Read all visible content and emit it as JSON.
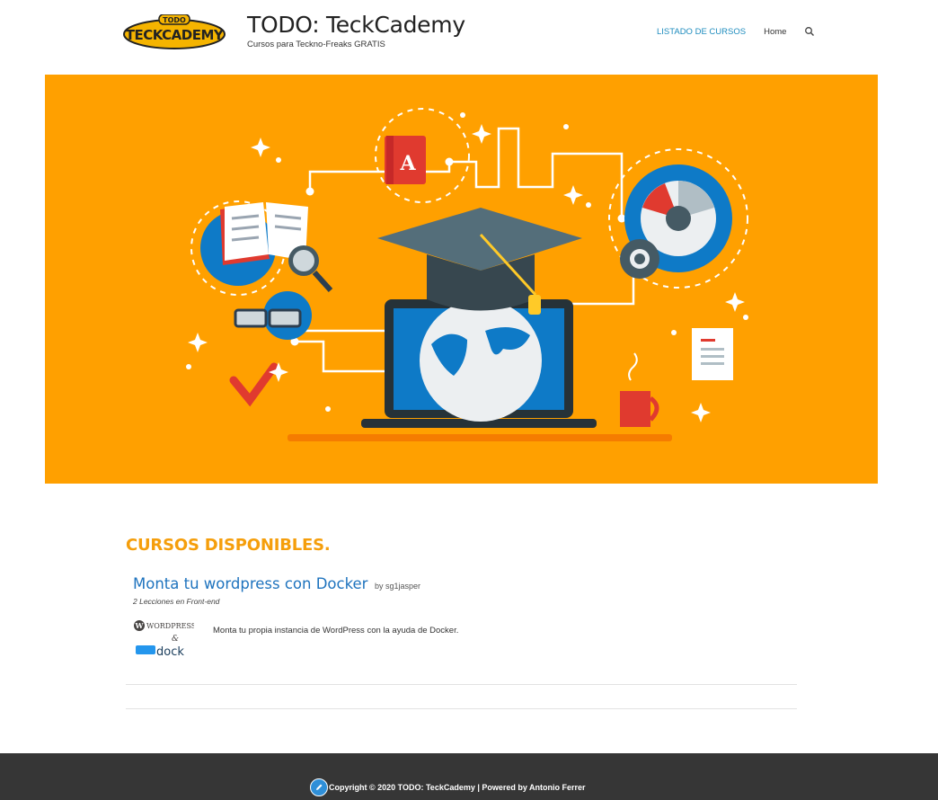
{
  "header": {
    "logo_text": "TECKCADEMY",
    "logo_small": "TODO",
    "site_title": "TODO: TeckCademy",
    "tagline": "Cursos para Teckno-Freaks GRATIS",
    "nav": [
      {
        "label": "LISTADO DE CURSOS",
        "active": true
      },
      {
        "label": "Home",
        "active": false
      }
    ],
    "search_icon": "search-icon"
  },
  "hero": {
    "background": "#ffa000",
    "book_letter": "A"
  },
  "section": {
    "title": "CURSOS DISPONIBLES."
  },
  "course": {
    "title": "Monta tu wordpress con Docker",
    "by": "by sg1jasper",
    "meta": "2 Lecciones en Front-end",
    "description": "Monta tu propia instancia de WordPress con la ayuda de Docker.",
    "thumb": {
      "line1": "WORDPRESS",
      "amp": "&",
      "line2": "dock"
    }
  },
  "footer": {
    "text": "Copyright © 2020 TODO: TeckCademy | Powered by Antonio Ferrer",
    "background": "#363636"
  },
  "colors": {
    "accent": "#1e8cbe",
    "section_title": "#f59e0b",
    "link": "#1e73be"
  }
}
